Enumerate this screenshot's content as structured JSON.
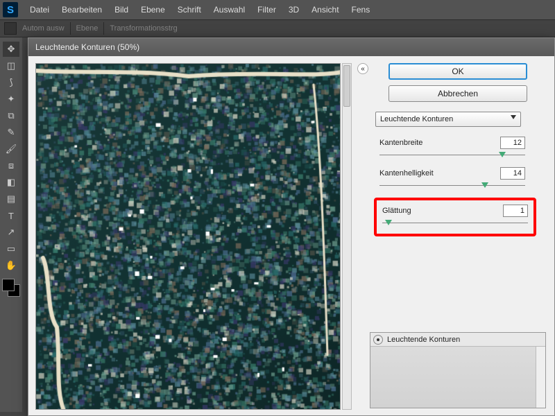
{
  "menu": {
    "items": [
      "Datei",
      "Bearbeiten",
      "Bild",
      "Ebene",
      "Schrift",
      "Auswahl",
      "Filter",
      "3D",
      "Ansicht",
      "Fens"
    ]
  },
  "optbar": {
    "auto": "Autom ausw",
    "layer": "Ebene",
    "trans": "Transformationsstrg"
  },
  "dialog": {
    "title": "Leuchtende Konturen (50%)",
    "ok": "OK",
    "cancel": "Abbrechen",
    "filter_combo": "Leuchtende Konturen",
    "params": {
      "edge_width": {
        "label": "Kantenbreite",
        "value": "12",
        "pos": 0.82
      },
      "edge_bright": {
        "label": "Kantenhelligkeit",
        "value": "14",
        "pos": 0.7
      },
      "smoothing": {
        "label": "Glättung",
        "value": "1",
        "pos": 0.02
      }
    },
    "layer_name": "Leuchtende Konturen"
  },
  "collapse_glyph": "«"
}
